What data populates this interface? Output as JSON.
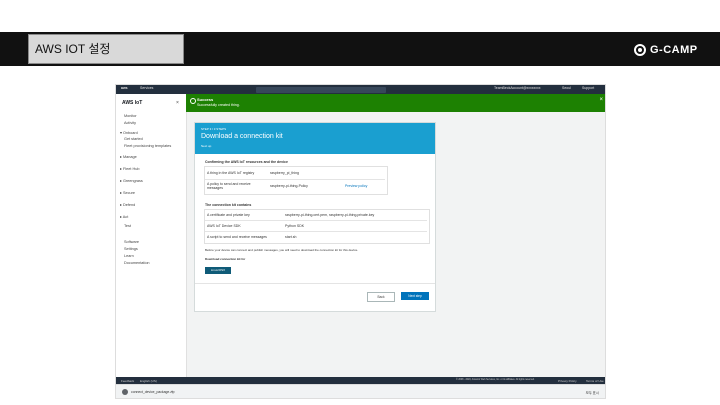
{
  "slide": {
    "title": "AWS IOT 설정",
    "brand": "G-CAMP"
  },
  "console": {
    "topbar": {
      "services": "Services",
      "account": "TeamBeckAccount@xxxxxxxx",
      "region": "Seoul",
      "support": "Support"
    },
    "sidebar": {
      "title": "AWS IoT",
      "items": [
        "Monitor",
        "Activity",
        "Onboard",
        "Get started",
        "Fleet provisioning templates",
        "Manage",
        "Fleet Hub",
        "Greengrass",
        "Secure",
        "Defend",
        "Act",
        "Test",
        "Software",
        "Settings",
        "Learn",
        "Documentation"
      ]
    },
    "banner": {
      "title": "Success",
      "message": "Successfully created thing."
    },
    "card": {
      "breadcrumb": "STEP 3 / 3 STEPS",
      "title": "Download a connection kit",
      "subtitle": "Next up",
      "section1": "Confirming the AWS IoT resources and the device",
      "row1_label": "A thing in the AWS IoT registry",
      "row1_value": "raspberry_pi_thing",
      "row2_label": "A policy to send and receive messages",
      "row2_value": "raspberry-pi-thing-Policy",
      "row2_link": "Preview policy",
      "section2": "The connection kit contains",
      "kit1_label": "A certificate and private key",
      "kit1_value": "raspberry-pi-thing.cert.pem, raspberry-pi-thing.private.key",
      "kit2_label": "AWS IoT Device SDK",
      "kit2_value": "Python SDK",
      "kit3_label": "A script to send and receive messages",
      "kit3_value": "start.sh",
      "note": "Before your device can connect and publish messages, you will need to download the connection kit for this device.",
      "download_label": "Download connection kit for",
      "download_os": "Linux/OSX",
      "back": "Back",
      "next": "Next step"
    },
    "footer": {
      "feedback": "Feedback",
      "language": "English (US)",
      "copyright": "© 2008 - 2020, Amazon Web Services, Inc. or its affiliates. All rights reserved.",
      "privacy": "Privacy Policy",
      "terms": "Terms of Use"
    },
    "downloads": {
      "file": "connect_device_package.zip",
      "show_all": "모두 표시"
    }
  }
}
